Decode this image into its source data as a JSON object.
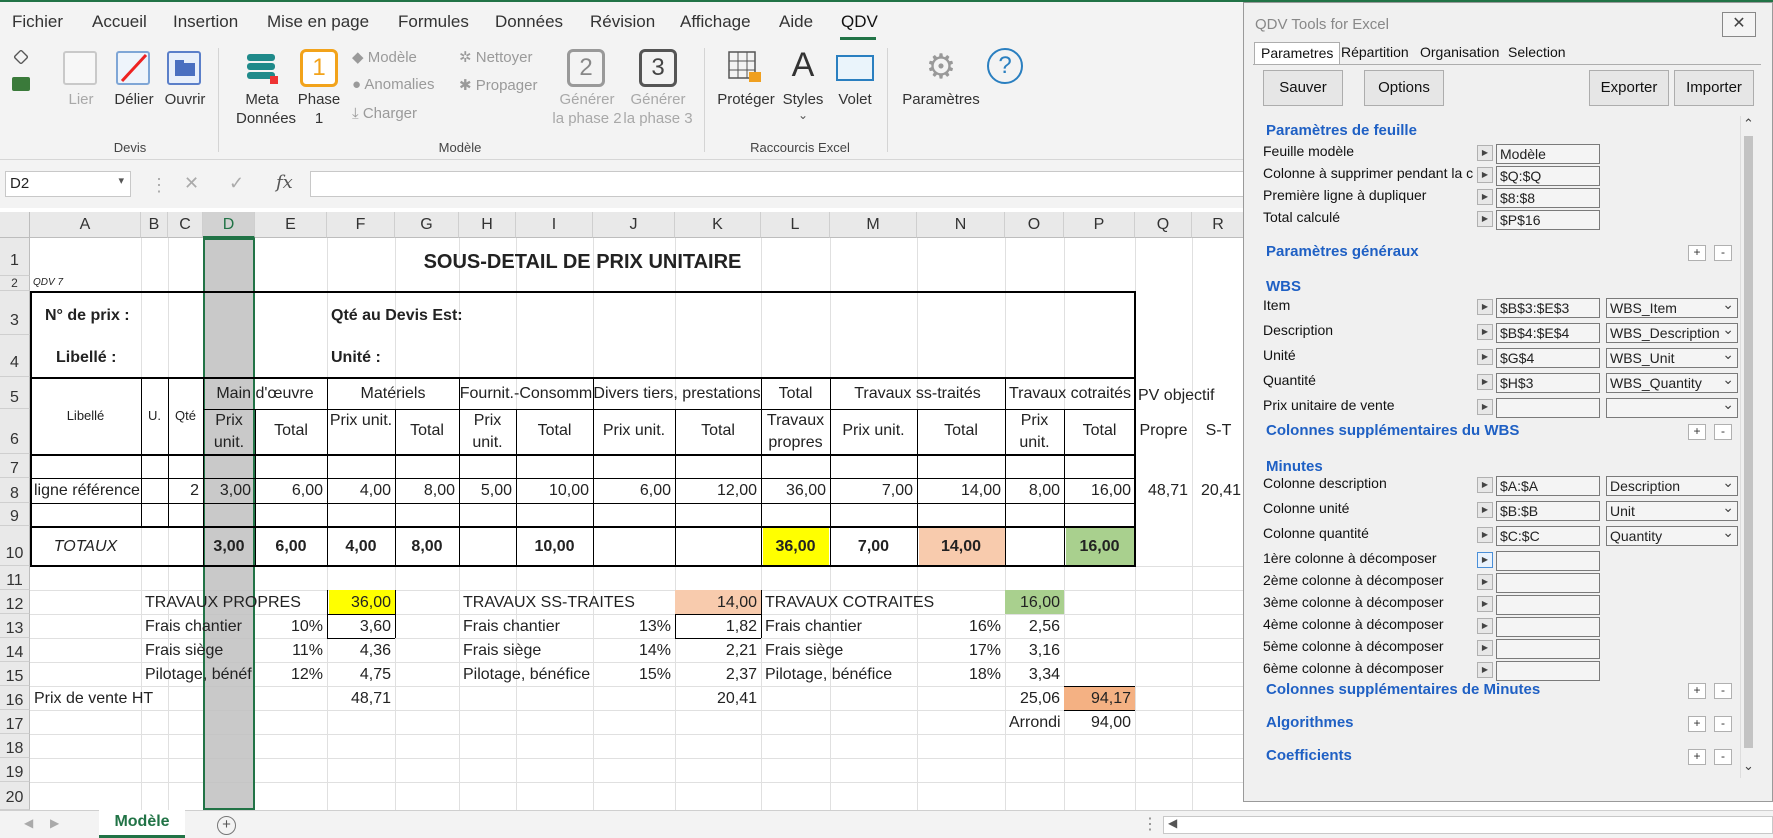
{
  "menu": {
    "items": [
      "Fichier",
      "Accueil",
      "Insertion",
      "Mise en page",
      "Formules",
      "Données",
      "Révision",
      "Affichage",
      "Aide",
      "QDV"
    ]
  },
  "ribbon": {
    "devis": {
      "group": "Devis",
      "lier": "Lier",
      "delier": "Délier",
      "ouvrir": "Ouvrir"
    },
    "modele": {
      "group": "Modèle",
      "meta1": "Meta",
      "meta2": "Données",
      "phase1a": "Phase",
      "phase1b": "1",
      "phase1_num": "1",
      "modele": "Modèle",
      "anomalies": "Anomalies",
      "charger": "Charger",
      "nettoyer": "Nettoyer",
      "propager": "Propager",
      "phase2_num": "2",
      "phase3_num": "3",
      "gen2a": "Générer",
      "gen2b": "la phase 2",
      "gen3a": "Générer",
      "gen3b": "la phase 3"
    },
    "raccourcis": {
      "group": "Raccourcis Excel",
      "proteger": "Protéger",
      "styles": "Styles",
      "volet": "Volet"
    },
    "parametres": "Paramètres"
  },
  "formula_bar": {
    "name_box": "D2",
    "fx": "fx",
    "value": ""
  },
  "columns": [
    "A",
    "B",
    "C",
    "D",
    "E",
    "F",
    "G",
    "H",
    "I",
    "J",
    "K",
    "L",
    "M",
    "N",
    "O",
    "P",
    "Q",
    "R"
  ],
  "rows": [
    "1",
    "2",
    "3",
    "4",
    "5",
    "6",
    "7",
    "8",
    "9",
    "10",
    "11",
    "12",
    "13",
    "14",
    "15",
    "16",
    "17",
    "18",
    "19",
    "20"
  ],
  "sheet": {
    "title": "SOUS-DETAIL DE PRIX UNITAIRE",
    "qdv": "QDV 7",
    "n_prix": "N° de prix :",
    "qte_devis": "Qté au Devis Est:",
    "libelle_label": "Libellé :",
    "unite": "Unité :",
    "hdr": {
      "libelle": "Libellé",
      "u": "U.",
      "qte": "Qté",
      "main": "Main d'œuvre",
      "materiels": "Matériels",
      "fournit": "Fournit.-Consomm",
      "divers": "Divers tiers, prestations",
      "total": "Total",
      "travaux_propres": "Travaux propres",
      "ss_traites": "Travaux ss-traités",
      "cotraites": "Travaux cotraités",
      "pv": "PV objectif",
      "prix_unit": "Prix unit.",
      "prix_unit2": "Prix unit.",
      "total_lbl": "Total",
      "propre": "Propre",
      "st": "S-T"
    },
    "row8": [
      "ligne référence",
      "2",
      "3,00",
      "6,00",
      "4,00",
      "8,00",
      "5,00",
      "10,00",
      "6,00",
      "12,00",
      "36,00",
      "7,00",
      "14,00",
      "8,00",
      "16,00",
      "48,71",
      "20,41"
    ],
    "totaux": {
      "label": "TOTAUX",
      "d": "3,00",
      "e": "6,00",
      "f": "4,00",
      "g": "8,00",
      "i": "10,00",
      "l": "36,00",
      "m": "7,00",
      "n": "14,00",
      "p": "16,00"
    },
    "recap": {
      "tp": "TRAVAUX PROPRES",
      "tp_v": "36,00",
      "fc": "Frais chantier",
      "fc_p": "10%",
      "fc_v": "3,60",
      "fs": "Frais siège",
      "fs_p": "11%",
      "fs_v": "4,36",
      "pb": "Pilotage, bénéf",
      "pb_p": "12%",
      "pb_v": "4,75",
      "st": "TRAVAUX SS-TRAITES",
      "st_v": "14,00",
      "st_fc": "Frais chantier",
      "st_fc_p": "13%",
      "st_fc_v": "1,82",
      "st_fs": "Frais siège",
      "st_fs_p": "14%",
      "st_fs_v": "2,21",
      "st_pb": "Pilotage, bénéfice",
      "st_pb_p": "15%",
      "st_pb_v": "2,37",
      "ct": "TRAVAUX COTRAITES",
      "ct_v": "16,00",
      "ct_fc": "Frais chantier",
      "ct_fc_p": "16%",
      "ct_fc_v": "2,56",
      "ct_fs": "Frais siège",
      "ct_fs_p": "17%",
      "ct_fs_v": "3,16",
      "ct_pb": "Pilotage, bénéfice",
      "ct_pb_p": "18%",
      "ct_pb_v": "3,34",
      "pvht": "Prix de vente HT",
      "pvht_f": "48,71",
      "pvht_k": "20,41",
      "pvht_o": "25,06",
      "pvht_p": "94,17",
      "arrondi": "Arrondi",
      "arrondi_v": "94,00"
    }
  },
  "tabs": {
    "active": "Modèle"
  },
  "panel": {
    "title": "QDV Tools for Excel",
    "close": "✕",
    "tabs": [
      "Parametres",
      "Répartition",
      "Organisation",
      "Selection"
    ],
    "buttons": {
      "sauver": "Sauver",
      "options": "Options",
      "exporter": "Exporter",
      "importer": "Importer"
    },
    "sec_feuille": "Paramètres de feuille",
    "feuille": [
      {
        "label": "Feuille modèle",
        "value": "Modèle"
      },
      {
        "label": "Colonne à supprimer pendant la co",
        "value": "$Q:$Q"
      },
      {
        "label": "Première ligne à dupliquer",
        "value": "$8:$8"
      },
      {
        "label": "Total calculé",
        "value": "$P$16"
      }
    ],
    "sec_generaux": "Paramètres généraux",
    "sec_wbs": "WBS",
    "wbs": [
      {
        "label": "Item",
        "value": "$B$3:$E$3",
        "dd": "WBS_Item"
      },
      {
        "label": "Description",
        "value": "$B$4:$E$4",
        "dd": "WBS_Description"
      },
      {
        "label": "Unité",
        "value": "$G$4",
        "dd": "WBS_Unit"
      },
      {
        "label": "Quantité",
        "value": "$H$3",
        "dd": "WBS_Quantity"
      },
      {
        "label": "Prix unitaire de vente",
        "value": "",
        "dd": ""
      }
    ],
    "sec_wbs_sup": "Colonnes supplémentaires du WBS",
    "sec_minutes": "Minutes",
    "minutes": [
      {
        "label": "Colonne description",
        "value": "$A:$A",
        "dd": "Description"
      },
      {
        "label": "Colonne unité",
        "value": "$B:$B",
        "dd": "Unit"
      },
      {
        "label": "Colonne quantité",
        "value": "$C:$C",
        "dd": "Quantity"
      }
    ],
    "decomp": [
      "1ère colonne à décomposer",
      "2ème colonne à décomposer",
      "3ème colonne à décomposer",
      "4ème colonne à décomposer",
      "5ème colonne à décomposer",
      "6ème colonne à décomposer"
    ],
    "sec_minutes_sup": "Colonnes supplémentaires de Minutes",
    "sec_algo": "Algorithmes",
    "sec_coef": "Coefficients",
    "plus": "+",
    "minus": "-"
  },
  "colors": {
    "excel_green": "#217346",
    "yellow": "#ffff00",
    "peach": "#f8cbad",
    "green": "#a9d08e",
    "orange": "#f4b183",
    "link_blue": "#1f60c4"
  }
}
